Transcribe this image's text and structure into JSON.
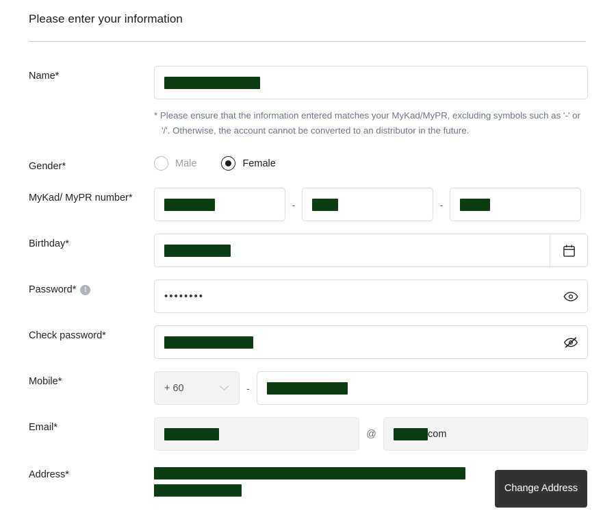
{
  "form": {
    "title": "Please enter your information",
    "hint": "* Please ensure that the information entered matches your MyKad/MyPR, excluding symbols such as '-' or '/'. Otherwise, the account cannot be converted to an distributor in the future.",
    "labels": {
      "name": "Name*",
      "gender": "Gender*",
      "mykad": "MyKad/ MyPR number*",
      "birthday": "Birthday*",
      "password": "Password*",
      "check_password": "Check password*",
      "mobile": "Mobile*",
      "email": "Email*",
      "address": "Address*"
    },
    "gender": {
      "options": [
        {
          "label": "Male",
          "selected": false
        },
        {
          "label": "Female",
          "selected": true
        }
      ]
    },
    "mykad": {
      "separator": "-"
    },
    "password": {
      "value": "••••••••",
      "info_icon": "info-icon",
      "toggle_icon": "eye-icon"
    },
    "check_password": {
      "toggle_icon": "eye-off-icon"
    },
    "birthday": {
      "icon": "calendar-icon"
    },
    "mobile": {
      "country_code": "+ 60",
      "separator": "-",
      "dropdown_icon": "chevron-down-icon"
    },
    "email": {
      "at_symbol": "@",
      "domain_suffix": "com"
    },
    "address": {
      "change_button": "Change\nAddress"
    },
    "colors": {
      "redaction": "#0c3d12",
      "button": "#333333",
      "border": "#dcdcdc",
      "readonly_bg": "#f4f4f4",
      "hint_text": "#6d7684"
    }
  }
}
